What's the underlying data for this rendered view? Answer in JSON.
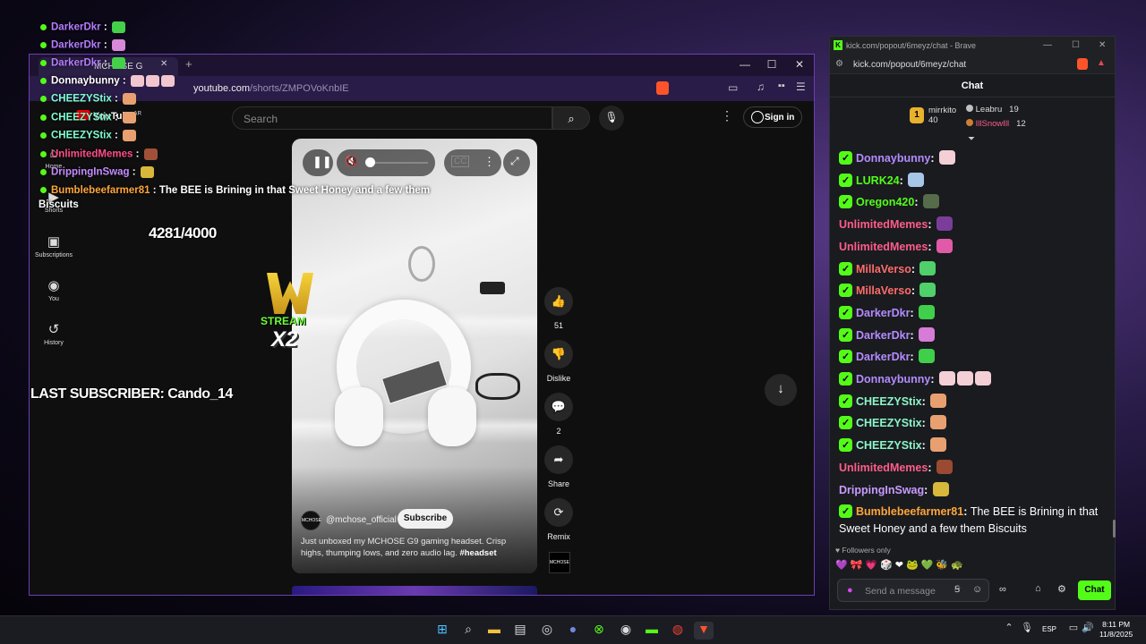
{
  "yt": {
    "tab_title": "MCHOSE G",
    "url_host": "youtube.com",
    "url_path": "/shorts/ZMPOVoKnbIE",
    "search_placeholder": "Search",
    "sign_in": "Sign in",
    "logo_text": "YouTube",
    "logo_region": "AR",
    "sidebar": [
      {
        "label": "Shorts",
        "icon": "shorts-icon"
      },
      {
        "label": "Subscriptions",
        "icon": "subscriptions-icon"
      },
      {
        "label": "You",
        "icon": "you-icon"
      },
      {
        "label": "History",
        "icon": "history-icon"
      }
    ],
    "sidebar_home": "Home",
    "channel": "@mchose_official",
    "channel_avatar": "MCHOSE",
    "subscribe": "Subscribe",
    "description": "Just unboxed my MCHOSE G9 gaming headset. Crisp highs, thumping lows, and zero audio lag.",
    "hashtag": "#headset",
    "actions": {
      "likes": "51",
      "dislike": "Dislike",
      "comments": "2",
      "share": "Share",
      "remix": "Remix"
    },
    "brand_logo": "MCHOSE"
  },
  "overlay": {
    "chat": [
      {
        "user": "DarkerDkr",
        "color": "#b67cff",
        "emotes": [
          "#45d04a"
        ]
      },
      {
        "user": "DarkerDkr",
        "color": "#b67cff",
        "emotes": [
          "#d88ad8"
        ]
      },
      {
        "user": "DarkerDkr",
        "color": "#b67cff",
        "emotes": [
          "#45d04a"
        ]
      },
      {
        "user": "Donnaybunny",
        "color": "#ffffff",
        "emotes": [
          "#f2c6cf",
          "#f2c6cf",
          "#f2c6cf"
        ]
      },
      {
        "user": "CHEEZYStix",
        "color": "#7fffd4",
        "emotes": [
          "#e8a070"
        ]
      },
      {
        "user": "CHEEZYStix",
        "color": "#7fffd4",
        "emotes": [
          "#e8a070"
        ]
      },
      {
        "user": "CHEEZYStix",
        "color": "#7fffd4",
        "emotes": [
          "#e8a070"
        ]
      },
      {
        "user": "UnlimitedMemes",
        "color": "#ff4d8a",
        "emotes": [
          "#a05038"
        ]
      },
      {
        "user": "DrippingInSwag",
        "color": "#c58cff",
        "emotes": [
          "#d8b83a"
        ]
      }
    ],
    "last_chat_user": "Bumblebeefarmer81",
    "last_chat_msg": "The BEE is Brining in that Sweet Honey and a few them",
    "last_chat_cont": "Biscuits",
    "sub_goal": "4281/4000",
    "last_subscriber": "LAST SUBSCRIBER: Cando_14",
    "w_stream": "STREAM",
    "w_x2": "X2"
  },
  "kick": {
    "window_title": "kick.com/popout/6meyz/chat - Brave",
    "url": "kick.com/popout/6meyz/chat",
    "header": "Chat",
    "podium": [
      {
        "rank": "1",
        "user": "mirrkito",
        "count": "40"
      },
      {
        "user": "Leabru",
        "count": "19"
      },
      {
        "user": "IllSnowIll",
        "count": "12"
      }
    ],
    "messages": [
      {
        "user": "Donnaybunny",
        "color": "#b58bff",
        "badge": true,
        "emotes": [
          "#f5cfd6"
        ]
      },
      {
        "user": "LURK24",
        "color": "#53fc18",
        "badge": true,
        "emotes": [
          "#a7c7e8"
        ]
      },
      {
        "user": "Oregon420",
        "color": "#53fc18",
        "badge": true,
        "emotes": [
          "#556b4a"
        ]
      },
      {
        "user": "UnlimitedMemes",
        "color": "#ff5c8a",
        "badge": false,
        "emotes": [
          "#7a3d9a"
        ]
      },
      {
        "user": "UnlimitedMemes",
        "color": "#ff5c8a",
        "badge": false,
        "emotes": [
          "#e05aa8"
        ]
      },
      {
        "user": "MillaVerso",
        "color": "#ff6b6b",
        "badge": true,
        "emotes": [
          "#4fd06a"
        ]
      },
      {
        "user": "MillaVerso",
        "color": "#ff6b6b",
        "badge": true,
        "emotes": [
          "#4fd06a"
        ]
      },
      {
        "user": "DarkerDkr",
        "color": "#b58bff",
        "badge": true,
        "emotes": [
          "#3fcf4a"
        ]
      },
      {
        "user": "DarkerDkr",
        "color": "#b58bff",
        "badge": true,
        "emotes": [
          "#d67cd6"
        ]
      },
      {
        "user": "DarkerDkr",
        "color": "#b58bff",
        "badge": true,
        "emotes": [
          "#3fcf4a"
        ]
      },
      {
        "user": "Donnaybunny",
        "color": "#b58bff",
        "badge": true,
        "emotes": [
          "#f5cfd6",
          "#f5cfd6",
          "#f5cfd6"
        ]
      },
      {
        "user": "CHEEZYStix",
        "color": "#8cf5c8",
        "badge": true,
        "emotes": [
          "#e8a070"
        ]
      },
      {
        "user": "CHEEZYStix",
        "color": "#8cf5c8",
        "badge": true,
        "emotes": [
          "#e8a070"
        ]
      },
      {
        "user": "CHEEZYStix",
        "color": "#8cf5c8",
        "badge": true,
        "emotes": [
          "#e8a070"
        ]
      },
      {
        "user": "UnlimitedMemes",
        "color": "#ff5c8a",
        "badge": false,
        "emotes": [
          "#9a4a30"
        ]
      },
      {
        "user": "DrippingInSwag",
        "color": "#c99bff",
        "badge": false,
        "emotes": [
          "#d8b83a"
        ]
      }
    ],
    "last_user": "Bumblebeefarmer81",
    "last_color": "#ffa53a",
    "last_msg": "The BEE is Brining in that Sweet Honey and a few them Biscuits",
    "followers_only": "Followers only",
    "send_placeholder": "Send a message",
    "chat_button": "Chat"
  },
  "taskbar": {
    "lang": "ESP",
    "time": "8:11 PM",
    "date": "11/8/2025"
  }
}
